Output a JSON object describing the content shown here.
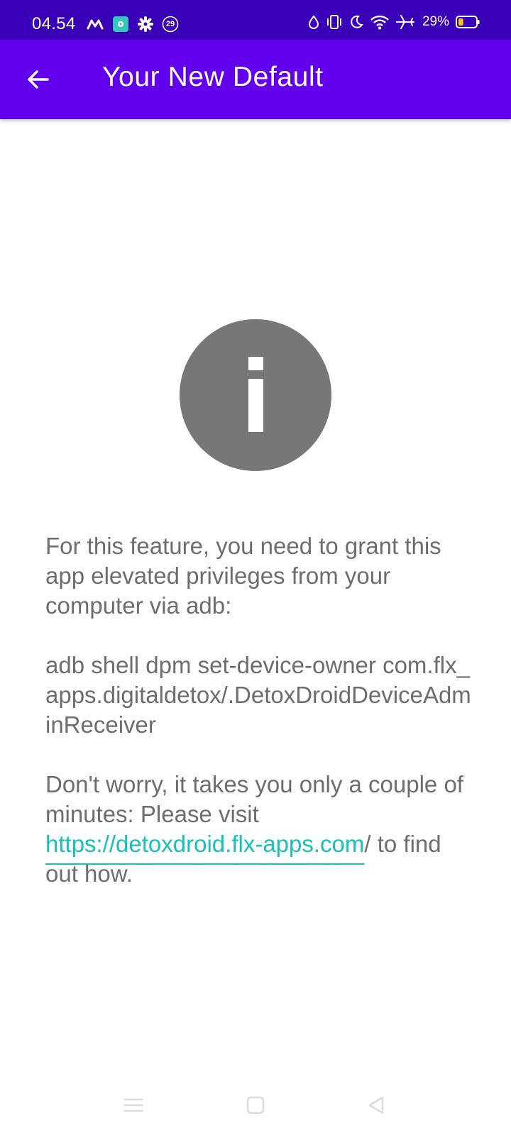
{
  "status_bar": {
    "time": "04.54",
    "notification_badge": "29",
    "battery_percent": "29%",
    "battery_level": 0.29,
    "battery_color": "#f5c518",
    "left_icons": [
      "m-logo-icon",
      "app-notification-icon",
      "settings-gear-icon",
      "badge-29-icon"
    ],
    "right_icons": [
      "drop-icon",
      "vibrate-icon",
      "moon-icon",
      "wifi-icon",
      "airplane-icon",
      "battery-icon"
    ]
  },
  "app_bar": {
    "title": "Your New Default",
    "back_icon": "arrow-back-icon",
    "color": "#6200ee"
  },
  "info": {
    "icon": "info-icon",
    "icon_color": "#777777"
  },
  "message": {
    "intro": "For this feature, you need to grant this app elevated privileges from your computer via adb:",
    "command": "adb shell dpm set-device-owner com.flx_apps.digitaldetox/.DetoxDroidDeviceAdminReceiver",
    "help_prefix": "Don't worry, it takes you only a couple of minutes: Please visit ",
    "help_link": "https://detoxdroid.flx-apps.com",
    "help_suffix": "/ to find out how.",
    "link_color": "#16c1b5"
  },
  "nav_bar": {
    "buttons": [
      "menu-icon",
      "home-icon",
      "back-triangle-icon"
    ]
  }
}
